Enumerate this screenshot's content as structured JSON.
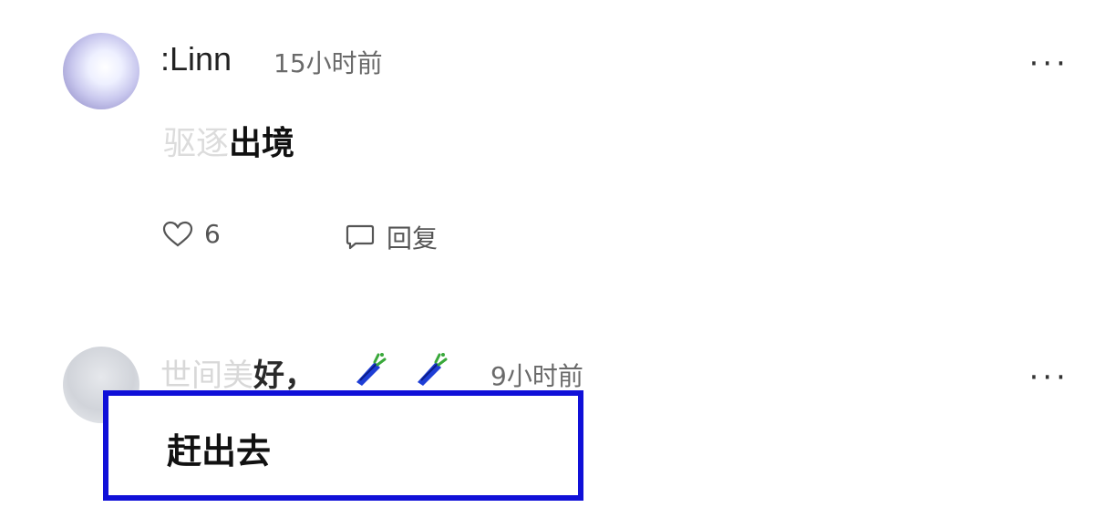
{
  "comments": [
    {
      "username": ":Linn",
      "time": "15小时前",
      "text_faded": "驱逐",
      "text": "出境",
      "likes": "6",
      "reply_label": "回复",
      "more": "···"
    },
    {
      "username_faded": "世间美",
      "username_tail": "好，",
      "time": "9小时前",
      "text": "赶出去",
      "more": "···"
    }
  ]
}
